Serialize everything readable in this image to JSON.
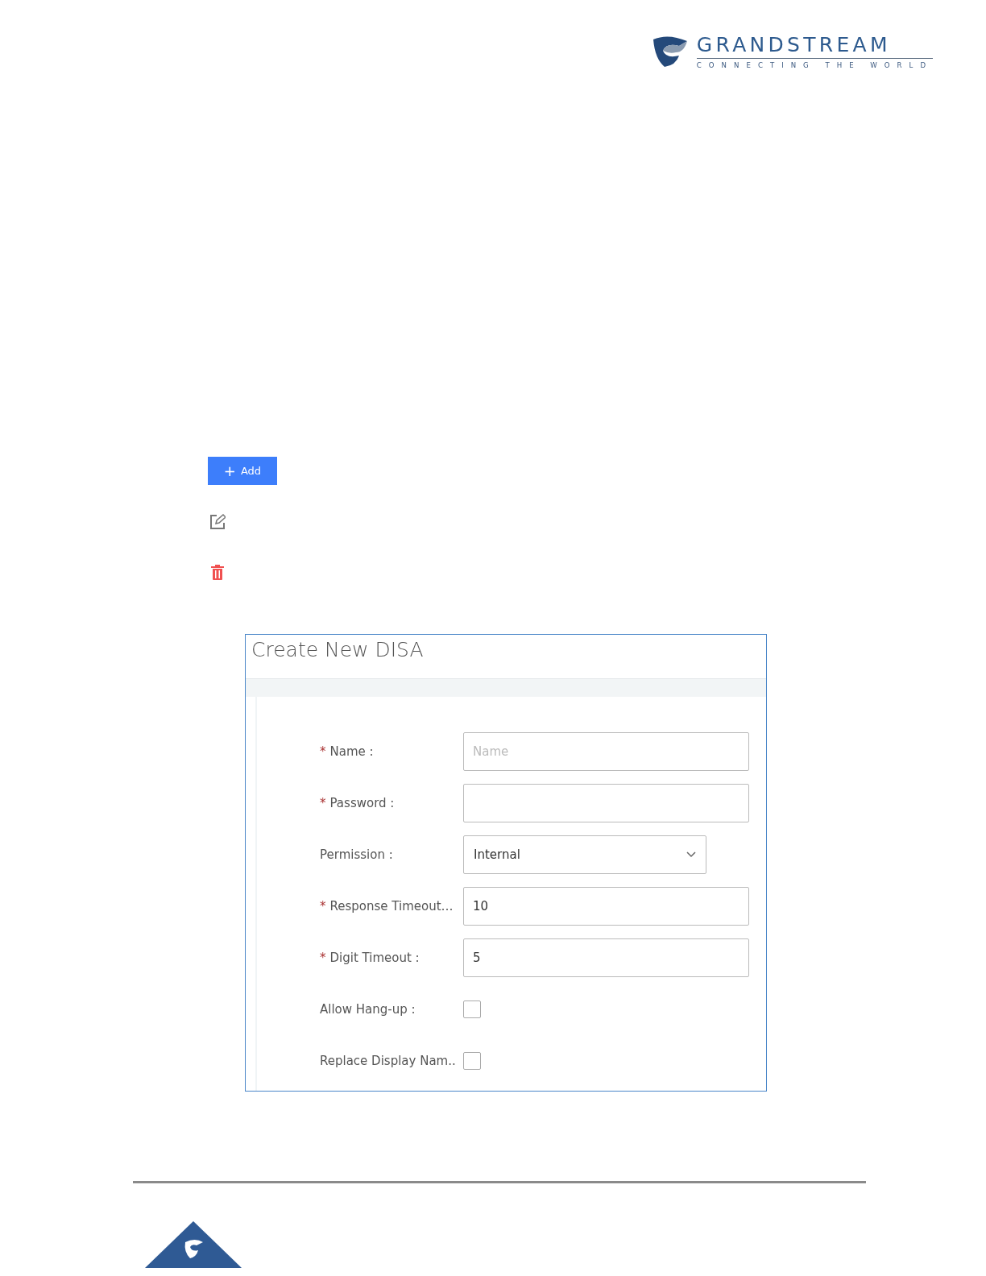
{
  "header": {
    "logo_name": "GRANDSTREAM",
    "logo_tagline": "CONNECTING THE WORLD"
  },
  "toolbar": {
    "add_button": {
      "icon": "+",
      "label": "Add"
    }
  },
  "dialog": {
    "title": "Create New DISA",
    "fields": [
      {
        "kind": "text",
        "required_mark": "*",
        "label": "Name :",
        "placeholder": "Name"
      },
      {
        "kind": "text",
        "required_mark": "*",
        "label": "Password :"
      },
      {
        "kind": "select",
        "label": "Permission :",
        "value": "Internal"
      },
      {
        "kind": "text",
        "required_mark": "*",
        "label": "Response Timeout…",
        "value": "10"
      },
      {
        "kind": "text",
        "required_mark": "*",
        "label": "Digit Timeout :",
        "value": "5"
      },
      {
        "kind": "checkbox",
        "label": "Allow Hang-up :",
        "checked": false
      },
      {
        "kind": "checkbox",
        "label": "Replace Display Nam..",
        "checked": false
      }
    ]
  }
}
